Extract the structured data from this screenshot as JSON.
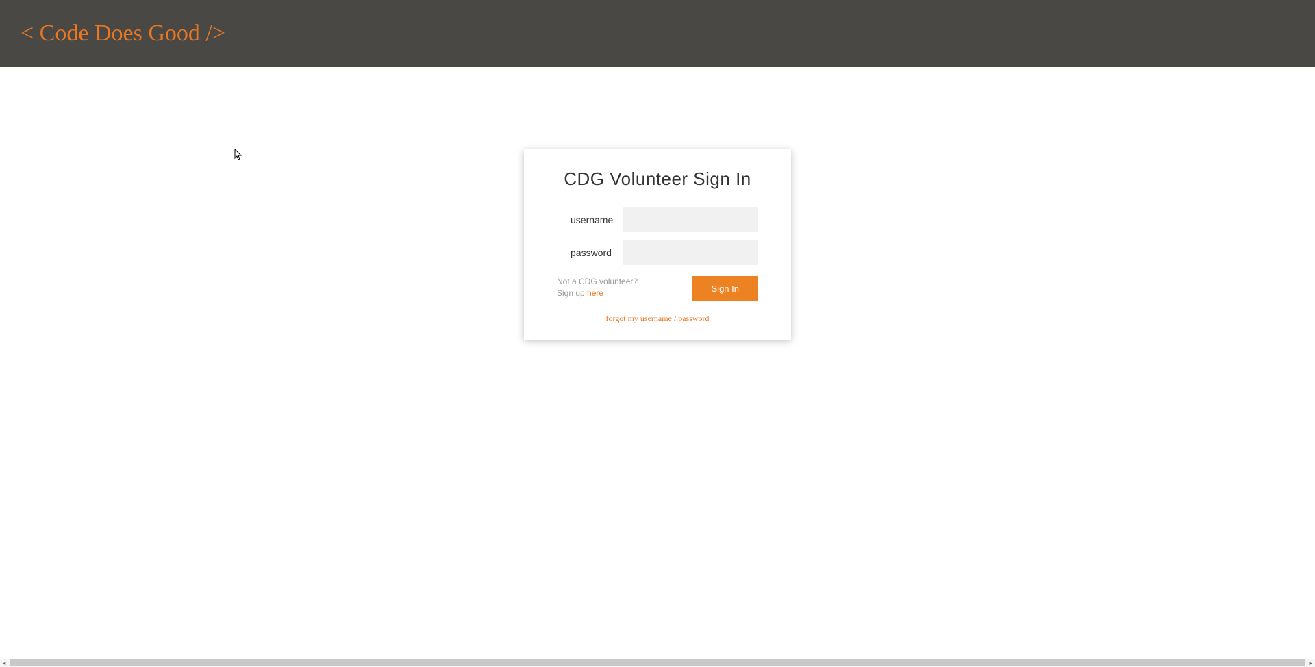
{
  "header": {
    "title": "< Code Does Good />"
  },
  "signin": {
    "title": "CDG Volunteer Sign In",
    "username_label": "username",
    "password_label": "password",
    "signup_prompt": "Not a CDG volunteer?",
    "signup_prefix": "Sign up ",
    "signup_link": "here",
    "button_label": "Sign In",
    "forgot_link": "forgot my username / password"
  },
  "colors": {
    "accent": "#e87722",
    "header_bg": "#494845"
  }
}
